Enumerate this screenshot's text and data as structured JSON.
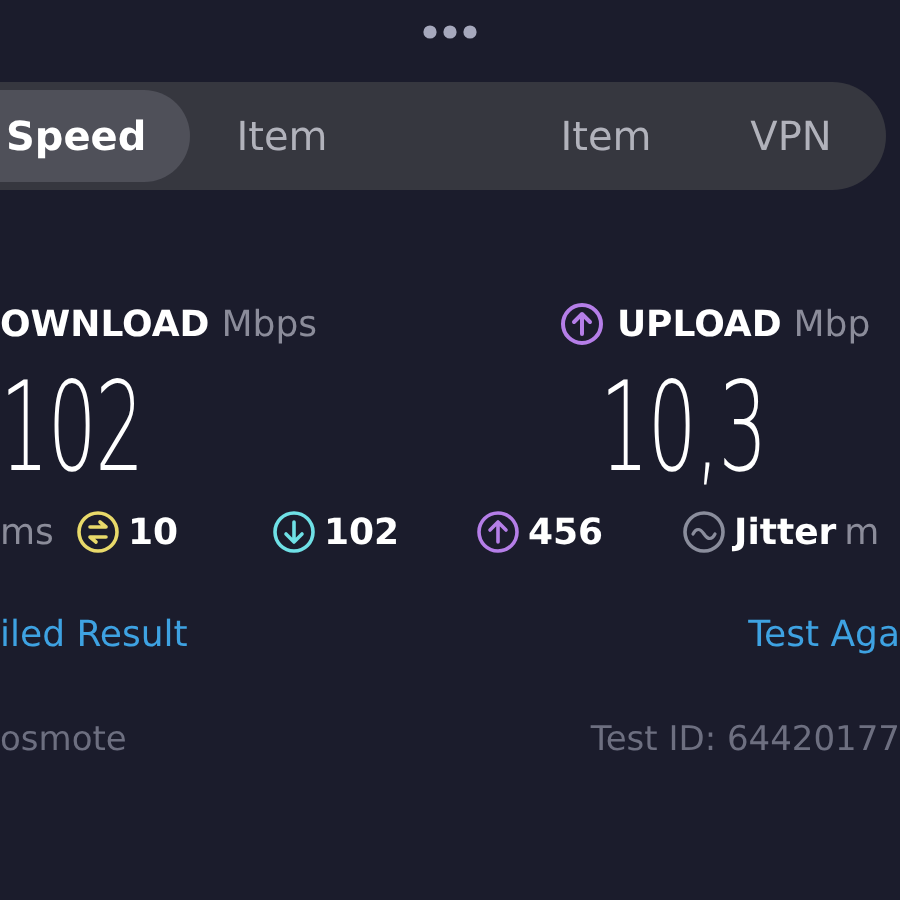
{
  "tabs": [
    {
      "label": "Speed",
      "selected": true
    },
    {
      "label": "Item",
      "selected": false
    },
    {
      "label": "Item",
      "selected": false
    },
    {
      "label": "VPN",
      "selected": false
    }
  ],
  "results": [
    {
      "kind": "download",
      "label": "OWNLOAD",
      "unit": "Mbps",
      "value": "102"
    },
    {
      "kind": "upload",
      "label": "UPLOAD",
      "unit": "Mbp",
      "value": "10,3"
    }
  ],
  "stats": [
    {
      "kind": "text",
      "label": "ms"
    },
    {
      "kind": "ping",
      "value": "10",
      "color": "#e8d96a"
    },
    {
      "kind": "down",
      "value": "102",
      "color": "#6fe0e6"
    },
    {
      "kind": "up",
      "value": "456",
      "color": "#b57ee8"
    },
    {
      "kind": "jitter",
      "label": "Jitter",
      "unit": "m",
      "color": "#8a8d9c"
    }
  ],
  "links": [
    "iled Result",
    "Test Aga"
  ],
  "footer": {
    "provider": "osmote",
    "test_id": "Test ID: 64420177"
  }
}
